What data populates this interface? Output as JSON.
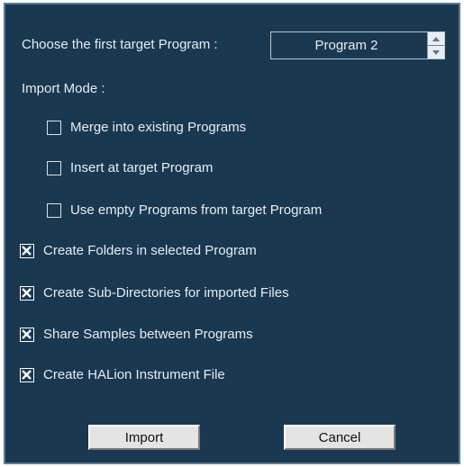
{
  "target_program": {
    "label": "Choose the first target Program :",
    "selected": "Program 2"
  },
  "import_mode": {
    "label": "Import Mode :",
    "options": [
      {
        "label": "Merge into existing Programs",
        "checked": false
      },
      {
        "label": "Insert at target Program",
        "checked": false
      },
      {
        "label": "Use empty Programs from target Program",
        "checked": false
      }
    ]
  },
  "options": [
    {
      "label": "Create Folders in selected Program",
      "checked": true
    },
    {
      "label": "Create Sub-Directories for imported Files",
      "checked": true
    },
    {
      "label": "Share Samples between Programs",
      "checked": true
    },
    {
      "label": "Create HALion Instrument File",
      "checked": true
    }
  ],
  "buttons": {
    "import": "Import",
    "cancel": "Cancel"
  },
  "colors": {
    "background": "#1a3850",
    "text": "#e6edf3",
    "button_face": "#e4e4e4"
  },
  "icons": {
    "checkmark": "x-check-icon",
    "stepper_up": "arrow-up-icon",
    "stepper_down": "arrow-down-icon"
  }
}
